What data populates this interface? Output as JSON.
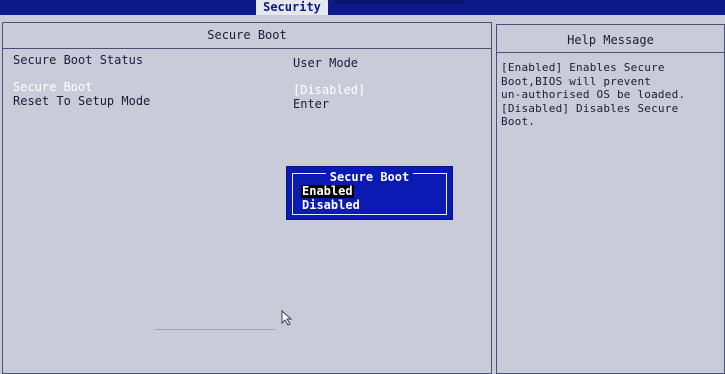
{
  "topbar": {
    "active_tab": "Security"
  },
  "main": {
    "title": "Secure Boot",
    "rows": [
      {
        "label": "Secure Boot Status",
        "value": "User Mode"
      },
      {
        "label": "Secure Boot",
        "value": "[Disabled]"
      },
      {
        "label": "Reset To Setup Mode",
        "value": "Enter"
      }
    ]
  },
  "help": {
    "title": "Help Message",
    "lines": [
      "[Enabled] Enables Secure",
      "Boot,BIOS will prevent",
      "un-authorised OS be loaded.",
      "[Disabled] Disables Secure",
      "Boot."
    ]
  },
  "popup": {
    "title": "Secure Boot",
    "options": [
      "Enabled",
      "Disabled"
    ],
    "selected": "Enabled"
  },
  "colors": {
    "background": "#c9cbd8",
    "topbar": "#0c1a8c",
    "popup": "#0c1ab4",
    "highlight_text": "#ffffff"
  }
}
